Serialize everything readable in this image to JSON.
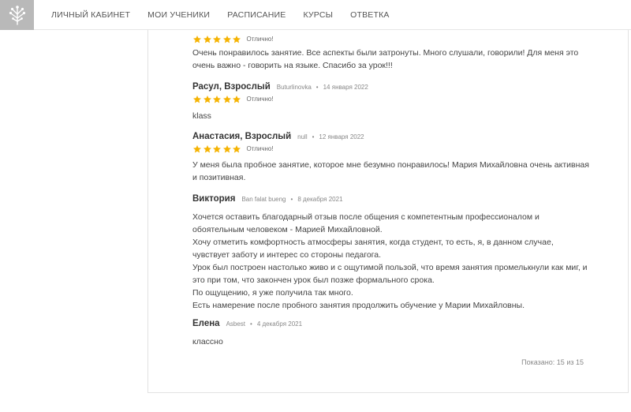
{
  "nav": {
    "items": [
      "ЛИЧНЫЙ КАБИНЕТ",
      "МОИ УЧЕНИКИ",
      "РАСПИСАНИЕ",
      "КУРСЫ",
      "ОТВЕТКА"
    ]
  },
  "reviews": [
    {
      "rating": 5,
      "rating_text": "Отлично!",
      "lines": [
        "Очень понравилось занятие. Все аспекты были затронуты. Много слушали, говорили! Для меня это",
        "очень важно - говорить на языке. Спасибо за урок!!!"
      ]
    },
    {
      "author": "Расул, Взрослый",
      "login": "Buturlinovka",
      "date": "14 января 2022",
      "rating": 5,
      "rating_text": "Отлично!",
      "lines": [
        "klass"
      ]
    },
    {
      "author": "Анастасия, Взрослый",
      "login": "null",
      "date": "12 января 2022",
      "rating": 5,
      "rating_text": "Отлично!",
      "lines": [
        "У меня была пробное занятие, которое мне безумно понравилось! Мария Михайловна очень активная",
        "и позитивная."
      ]
    },
    {
      "author": "Виктория",
      "login": "Ban falat bueng",
      "date": "8 декабря 2021",
      "lines": [
        "Хочется оставить благодарный отзыв после общения с компетентным профессионалом и",
        "обоятельным человеком - Марией Михайловной.",
        "Хочу отметить комфортность атмосферы занятия, когда студент, то есть, я, в данном случае,",
        "чувствует заботу и интерес со стороны педагога.",
        "Урок был построен настолько живо и с ощутимой пользой, что время занятия промелькнули как миг, и",
        "это при том, что закончен урок был позже формального срока.",
        "По ощущению, я уже получила так много.",
        "Есть намерение после пробного занятия продолжить обучение у Марии Михайловны."
      ]
    },
    {
      "author": "Елена",
      "login": "Asbest",
      "date": "4 декабря 2021",
      "lines": [
        "классно"
      ]
    }
  ],
  "footer": {
    "shown_label": "Показано:",
    "shown": "15",
    "of_label": "из",
    "total": "15"
  },
  "colors": {
    "star": "#f5b301",
    "logo_bg": "#b9b9b9"
  }
}
